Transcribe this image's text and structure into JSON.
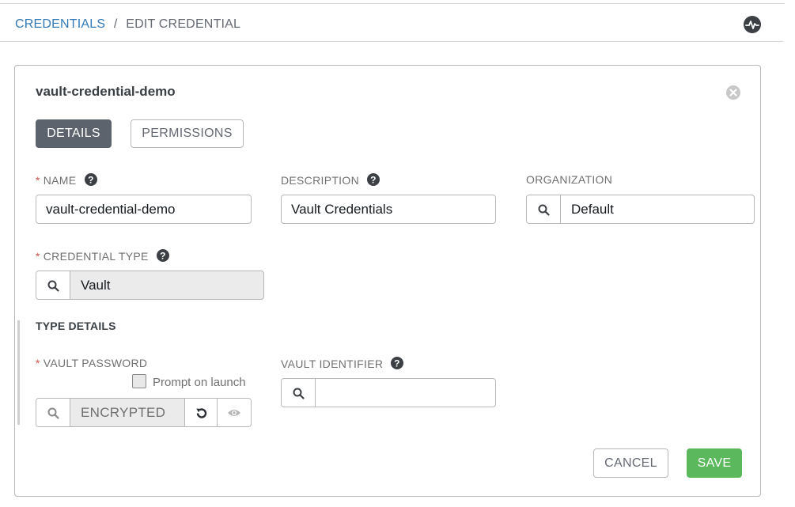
{
  "breadcrumb": {
    "link": "CREDENTIALS",
    "separator": "/",
    "current": "EDIT CREDENTIAL"
  },
  "icons": {
    "activity": "activity-stream-icon",
    "close": "close-circle-icon",
    "help": "question-circle-icon",
    "search": "search-icon",
    "revert": "revert-icon",
    "show": "eye-icon"
  },
  "card": {
    "title": "vault-credential-demo"
  },
  "tabs": {
    "details": "DETAILS",
    "permissions": "PERMISSIONS"
  },
  "fields": {
    "name": {
      "required": "*",
      "label": "NAME",
      "value": "vault-credential-demo"
    },
    "description": {
      "label": "DESCRIPTION",
      "value": "Vault Credentials"
    },
    "organization": {
      "label": "ORGANIZATION",
      "value": "Default"
    },
    "credential_type": {
      "required": "*",
      "label": "CREDENTIAL TYPE",
      "value": "Vault"
    }
  },
  "type_details": {
    "title": "TYPE DETAILS",
    "vault_password": {
      "required": "*",
      "label": "VAULT PASSWORD",
      "value": "ENCRYPTED",
      "prompt_on_launch": "Prompt on launch",
      "prompt_checked": false
    },
    "vault_identifier": {
      "label": "VAULT IDENTIFIER",
      "value": ""
    }
  },
  "actions": {
    "cancel": "CANCEL",
    "save": "SAVE"
  },
  "colors": {
    "link": "#337ab7",
    "active_tab": "#5d636c",
    "save": "#5cb85c",
    "required": "#d9534f"
  }
}
